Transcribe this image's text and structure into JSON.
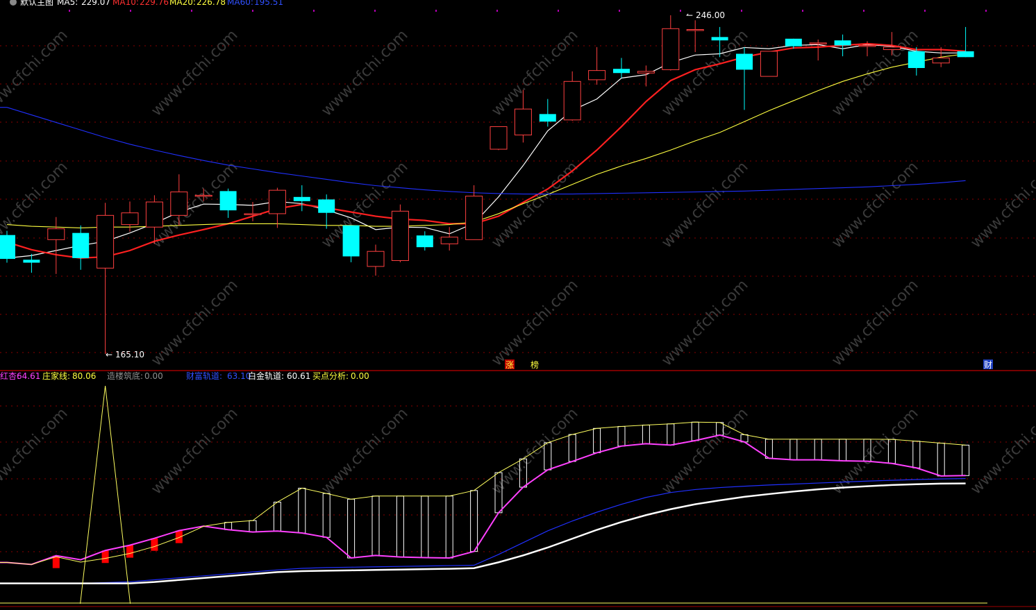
{
  "main_legend": {
    "prefix_icon": "circle-check-icon",
    "title": "默认主图",
    "items": [
      {
        "label": "MA5:",
        "value": "229.07",
        "color": "#ffffff"
      },
      {
        "label": "MA10:",
        "value": "229.76",
        "color": "#ff3030"
      },
      {
        "label": "MA20:",
        "value": "226.78",
        "color": "#ffff40"
      },
      {
        "label": "MA60:",
        "value": "195.51",
        "color": "#3050ff"
      }
    ]
  },
  "sub_legend": {
    "items": [
      {
        "label": "红杏:",
        "value": "64.61",
        "color": "#ff40ff"
      },
      {
        "label": "庄家线:",
        "value": "80.06",
        "color": "#ffff40"
      },
      {
        "label": "造楼筑底:",
        "value": "0.00",
        "color": "#909090"
      },
      {
        "label": "财富轨道:",
        "value": "63.10",
        "color": "#3050ff"
      },
      {
        "label": "白金轨道:",
        "value": "60.61",
        "color": "#ffffff"
      },
      {
        "label": "买点分析:",
        "value": "0.00",
        "color": "#ffff40"
      }
    ]
  },
  "annotations": {
    "high_label": "246.00",
    "low_label": "165.10",
    "markers": [
      {
        "text": "涨",
        "bg": "#c00000",
        "fg": "#ffff40"
      },
      {
        "text": "榜",
        "bg": "#000000",
        "fg": "#ffff40"
      },
      {
        "text": "财",
        "bg": "#2040c0",
        "fg": "#ffffff"
      }
    ]
  },
  "watermark": "www.cfchi.com",
  "colors": {
    "up": "#ff4040",
    "down": "#00ffff",
    "ma5": "#ffffff",
    "ma10": "#ff2020",
    "ma20": "#ffff40",
    "ma60": "#2030ff",
    "grid": "#8b0000"
  },
  "chart_data": [
    {
      "type": "candlestick",
      "title": "默认主图",
      "ylim": [
        160,
        250
      ],
      "candles": [
        {
          "o": 193.5,
          "c": 187.8,
          "h": 194.5,
          "l": 186.9
        },
        {
          "o": 187.6,
          "c": 186.9,
          "h": 189.0,
          "l": 184.5
        },
        {
          "o": 192.4,
          "c": 195.0,
          "h": 197.8,
          "l": 184.2
        },
        {
          "o": 194.0,
          "c": 188.0,
          "h": 195.8,
          "l": 185.2
        },
        {
          "o": 185.6,
          "c": 198.2,
          "h": 201.2,
          "l": 165.1
        },
        {
          "o": 196.0,
          "c": 198.8,
          "h": 201.5,
          "l": 194.3
        },
        {
          "o": 195.4,
          "c": 201.4,
          "h": 203.0,
          "l": 191.4
        },
        {
          "o": 198.2,
          "c": 203.8,
          "h": 208.0,
          "l": 195.8
        },
        {
          "o": 203.0,
          "c": 203.0,
          "h": 204.6,
          "l": 201.6
        },
        {
          "o": 204.0,
          "c": 199.4,
          "h": 204.6,
          "l": 197.6
        },
        {
          "o": 198.6,
          "c": 198.6,
          "h": 201.4,
          "l": 196.8
        },
        {
          "o": 198.6,
          "c": 204.2,
          "h": 204.8,
          "l": 195.2
        },
        {
          "o": 202.6,
          "c": 201.6,
          "h": 205.4,
          "l": 199.2
        },
        {
          "o": 202.0,
          "c": 198.8,
          "h": 203.2,
          "l": 195.0
        },
        {
          "o": 195.8,
          "c": 188.4,
          "h": 195.8,
          "l": 187.0
        },
        {
          "o": 186.0,
          "c": 189.6,
          "h": 191.2,
          "l": 183.8
        },
        {
          "o": 187.4,
          "c": 199.2,
          "h": 200.8,
          "l": 187.0
        },
        {
          "o": 193.4,
          "c": 190.6,
          "h": 194.4,
          "l": 189.8
        },
        {
          "o": 191.4,
          "c": 193.0,
          "h": 195.4,
          "l": 189.8
        },
        {
          "o": 192.4,
          "c": 202.8,
          "h": 205.4,
          "l": 192.4
        },
        {
          "o": 214.0,
          "c": 219.4,
          "h": 219.4,
          "l": 213.8
        },
        {
          "o": 217.4,
          "c": 223.6,
          "h": 228.2,
          "l": 215.6
        },
        {
          "o": 222.4,
          "c": 220.6,
          "h": 226.0,
          "l": 219.4
        },
        {
          "o": 221.0,
          "c": 230.2,
          "h": 232.6,
          "l": 220.8
        },
        {
          "o": 230.6,
          "c": 232.8,
          "h": 238.4,
          "l": 229.4
        },
        {
          "o": 233.2,
          "c": 232.2,
          "h": 235.8,
          "l": 231.0
        },
        {
          "o": 232.2,
          "c": 232.6,
          "h": 234.0,
          "l": 229.0
        },
        {
          "o": 233.0,
          "c": 242.8,
          "h": 246.0,
          "l": 232.8
        },
        {
          "o": 242.6,
          "c": 242.6,
          "h": 244.8,
          "l": 237.2
        },
        {
          "o": 240.8,
          "c": 240.0,
          "h": 243.2,
          "l": 236.0
        },
        {
          "o": 236.8,
          "c": 233.0,
          "h": 238.4,
          "l": 223.4
        },
        {
          "o": 231.4,
          "c": 237.4,
          "h": 237.4,
          "l": 231.4
        },
        {
          "o": 240.4,
          "c": 238.6,
          "h": 240.4,
          "l": 238.0
        },
        {
          "o": 239.4,
          "c": 239.4,
          "h": 240.2,
          "l": 235.2
        },
        {
          "o": 240.0,
          "c": 238.8,
          "h": 241.4,
          "l": 236.2
        },
        {
          "o": 238.8,
          "c": 238.8,
          "h": 239.8,
          "l": 236.2
        },
        {
          "o": 237.8,
          "c": 238.4,
          "h": 242.0,
          "l": 236.4
        },
        {
          "o": 237.4,
          "c": 233.4,
          "h": 238.4,
          "l": 231.6
        },
        {
          "o": 234.6,
          "c": 235.8,
          "h": 238.4,
          "l": 233.6
        },
        {
          "o": 237.4,
          "c": 236.0,
          "h": 243.2,
          "l": 236.0
        }
      ],
      "series": [
        {
          "name": "MA5",
          "values": [
            188.0,
            188.6,
            189.8,
            191.0,
            192.0,
            194.0,
            196.3,
            199.0,
            200.9,
            200.8,
            200.6,
            201.5,
            201.0,
            199.5,
            197.6,
            194.8,
            195.4,
            195.3,
            193.8,
            196.3,
            202.6,
            210.1,
            218.4,
            223.3,
            226.0,
            231.0,
            231.8,
            234.7,
            236.5,
            236.8,
            238.3,
            238.0,
            238.8,
            239.0,
            238.0,
            239.0,
            238.6,
            237.4,
            237.0,
            237.0
          ]
        },
        {
          "name": "MA10",
          "values": [
            191.8,
            190.0,
            188.8,
            188.0,
            188.3,
            189.8,
            192.0,
            193.5,
            194.8,
            196.2,
            198.0,
            199.8,
            200.8,
            200.0,
            199.0,
            198.0,
            197.3,
            197.0,
            196.2,
            196.2,
            198.0,
            201.3,
            204.5,
            208.8,
            213.8,
            219.4,
            225.4,
            230.4,
            233.0,
            234.4,
            236.0,
            237.2,
            238.2,
            238.4,
            238.8,
            239.2,
            238.8,
            237.8,
            237.8,
            237.4
          ]
        },
        {
          "name": "MA20",
          "values": [
            196.0,
            195.6,
            195.4,
            195.2,
            195.4,
            195.4,
            195.6,
            195.8,
            196.0,
            196.2,
            196.2,
            196.2,
            196.0,
            195.8,
            195.8,
            195.6,
            195.6,
            195.8,
            196.0,
            196.6,
            198.6,
            201.0,
            203.2,
            205.6,
            208.0,
            210.0,
            211.8,
            213.8,
            216.0,
            218.0,
            220.6,
            223.2,
            225.6,
            228.0,
            230.2,
            232.0,
            233.6,
            234.8,
            236.0,
            236.8
          ]
        },
        {
          "name": "MA60",
          "values": [
            224.0,
            222.2,
            220.4,
            218.6,
            216.8,
            215.2,
            213.8,
            212.5,
            211.3,
            210.2,
            209.3,
            208.4,
            207.6,
            206.8,
            206.0,
            205.3,
            204.8,
            204.3,
            203.9,
            203.6,
            203.4,
            203.3,
            203.3,
            203.3,
            203.4,
            203.5,
            203.6,
            203.7,
            203.8,
            203.9,
            204.0,
            204.2,
            204.4,
            204.6,
            204.8,
            205.0,
            205.3,
            205.6,
            206.0,
            206.5
          ]
        }
      ]
    },
    {
      "type": "line",
      "title": "",
      "ylim": [
        0,
        100
      ],
      "series": [
        {
          "name": "红杏",
          "values": [
            20.4,
            19.4,
            23.9,
            21.8,
            26.5,
            29.2,
            32.7,
            36.6,
            38.9,
            37.1,
            35.9,
            36.4,
            35.4,
            33.2,
            22.7,
            24.0,
            23.2,
            22.9,
            22.7,
            26.0,
            45.7,
            58.7,
            67.5,
            71.8,
            76.2,
            79.6,
            80.8,
            80.1,
            82.4,
            85.2,
            81.7,
            73.4,
            72.6,
            72.6,
            72.1,
            71.9,
            70.8,
            68.5,
            64.4,
            64.6
          ]
        },
        {
          "name": "庄家线",
          "values": [
            20.4,
            19.4,
            23.3,
            20.6,
            22.5,
            25.0,
            28.5,
            33.1,
            38.8,
            40.8,
            41.7,
            51.1,
            58.2,
            55.5,
            52.6,
            54.2,
            54.2,
            54.2,
            54.2,
            57.0,
            66.1,
            73.1,
            81.3,
            85.5,
            88.6,
            89.6,
            90.3,
            90.9,
            91.8,
            91.6,
            85.4,
            83.1,
            83.1,
            83.1,
            83.1,
            83.1,
            83.0,
            82.1,
            81.1,
            80.1
          ]
        },
        {
          "name": "财富轨道",
          "values": [
            9.8,
            9.8,
            9.8,
            9.8,
            10.2,
            10.6,
            11.6,
            12.6,
            13.6,
            14.6,
            15.6,
            16.6,
            17.4,
            17.8,
            18.0,
            18.2,
            18.4,
            18.6,
            18.8,
            19.0,
            24.5,
            30.5,
            36.5,
            41.5,
            46.0,
            50.0,
            53.5,
            56.0,
            57.5,
            58.5,
            59.2,
            59.8,
            60.3,
            60.8,
            61.3,
            61.8,
            62.2,
            62.6,
            62.9,
            63.1
          ]
        },
        {
          "name": "白金轨道",
          "values": [
            9.8,
            9.8,
            9.8,
            9.8,
            9.8,
            9.8,
            10.5,
            11.5,
            12.5,
            13.5,
            14.5,
            15.5,
            16.0,
            16.2,
            16.4,
            16.6,
            16.8,
            17.0,
            17.2,
            17.5,
            20.5,
            24.0,
            28.0,
            32.5,
            37.0,
            41.0,
            44.5,
            47.5,
            50.0,
            52.0,
            53.8,
            55.2,
            56.5,
            57.6,
            58.5,
            59.2,
            59.8,
            60.2,
            60.5,
            60.6
          ]
        },
        {
          "name": "造楼筑底",
          "values": [
            0,
            0,
            0,
            0,
            100,
            0,
            0,
            0,
            0,
            0,
            0,
            0,
            0,
            0,
            0,
            0,
            0,
            0,
            0,
            0,
            0,
            0,
            0,
            0,
            0,
            0,
            0,
            0,
            0,
            0,
            0,
            0,
            0,
            0,
            0,
            0,
            0,
            0,
            0,
            0
          ]
        }
      ],
      "red_bar_indices": [
        2,
        4,
        5,
        6,
        7
      ]
    }
  ]
}
